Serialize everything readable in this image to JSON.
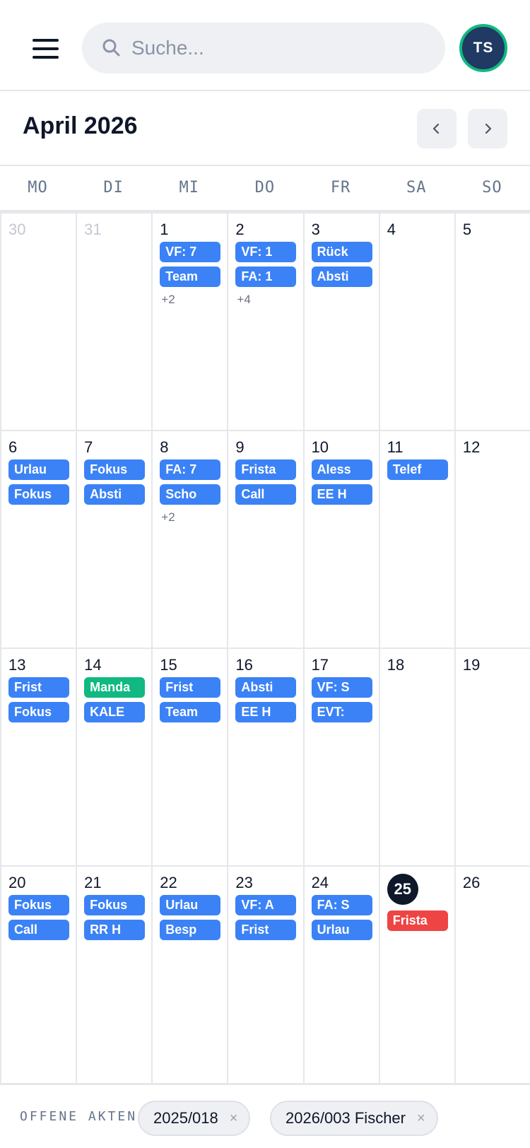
{
  "header": {
    "search_placeholder": "Suche...",
    "avatar_initials": "TS",
    "avatar_color": "#203a63",
    "avatar_ring_color": "#10b981"
  },
  "calendar": {
    "month_label": "April 2026",
    "prev_icon": "chevron-left-icon",
    "next_icon": "chevron-right-icon",
    "weekdays": [
      "MO",
      "DI",
      "MI",
      "DO",
      "FR",
      "SA",
      "SO"
    ],
    "weeks": [
      [
        {
          "day": "30",
          "outside": true,
          "events": []
        },
        {
          "day": "31",
          "outside": true,
          "events": []
        },
        {
          "day": "1",
          "events": [
            {
              "label": "VF: 7",
              "color": "blue"
            },
            {
              "label": "Team",
              "color": "blue"
            }
          ],
          "more": "+2"
        },
        {
          "day": "2",
          "events": [
            {
              "label": "VF: 1",
              "color": "blue"
            },
            {
              "label": "FA: 1",
              "color": "blue"
            }
          ],
          "more": "+4"
        },
        {
          "day": "3",
          "events": [
            {
              "label": "Rück",
              "color": "blue"
            },
            {
              "label": "Absti",
              "color": "blue"
            }
          ]
        },
        {
          "day": "4",
          "events": []
        },
        {
          "day": "5",
          "events": []
        }
      ],
      [
        {
          "day": "6",
          "events": [
            {
              "label": "Urlau",
              "color": "blue"
            },
            {
              "label": "Fokus",
              "color": "blue"
            }
          ]
        },
        {
          "day": "7",
          "events": [
            {
              "label": "Fokus",
              "color": "blue"
            },
            {
              "label": "Absti",
              "color": "blue"
            }
          ]
        },
        {
          "day": "8",
          "events": [
            {
              "label": "FA: 7",
              "color": "blue"
            },
            {
              "label": "Scho",
              "color": "blue"
            }
          ],
          "more": "+2"
        },
        {
          "day": "9",
          "events": [
            {
              "label": "Frista",
              "color": "blue"
            },
            {
              "label": "Call",
              "color": "blue"
            }
          ]
        },
        {
          "day": "10",
          "events": [
            {
              "label": "Aless",
              "color": "blue"
            },
            {
              "label": "EE H",
              "color": "blue"
            }
          ]
        },
        {
          "day": "11",
          "events": [
            {
              "label": "Telef",
              "color": "blue"
            }
          ]
        },
        {
          "day": "12",
          "events": []
        }
      ],
      [
        {
          "day": "13",
          "events": [
            {
              "label": "Frist",
              "color": "blue"
            },
            {
              "label": "Fokus",
              "color": "blue"
            }
          ]
        },
        {
          "day": "14",
          "events": [
            {
              "label": "Manda",
              "color": "green"
            },
            {
              "label": "KALE",
              "color": "blue"
            }
          ]
        },
        {
          "day": "15",
          "events": [
            {
              "label": "Frist",
              "color": "blue"
            },
            {
              "label": "Team",
              "color": "blue"
            }
          ]
        },
        {
          "day": "16",
          "events": [
            {
              "label": "Absti",
              "color": "blue"
            },
            {
              "label": "EE H",
              "color": "blue"
            }
          ]
        },
        {
          "day": "17",
          "events": [
            {
              "label": "VF: S",
              "color": "blue"
            },
            {
              "label": "EVT:",
              "color": "blue"
            }
          ]
        },
        {
          "day": "18",
          "events": []
        },
        {
          "day": "19",
          "events": []
        }
      ],
      [
        {
          "day": "20",
          "events": [
            {
              "label": "Fokus",
              "color": "blue"
            },
            {
              "label": "Call",
              "color": "blue"
            }
          ]
        },
        {
          "day": "21",
          "events": [
            {
              "label": "Fokus",
              "color": "blue"
            },
            {
              "label": "RR H",
              "color": "blue"
            }
          ]
        },
        {
          "day": "22",
          "events": [
            {
              "label": "Urlau",
              "color": "blue"
            },
            {
              "label": "Besp",
              "color": "blue"
            }
          ]
        },
        {
          "day": "23",
          "events": [
            {
              "label": "VF: A",
              "color": "blue"
            },
            {
              "label": "Frist",
              "color": "blue"
            }
          ]
        },
        {
          "day": "24",
          "events": [
            {
              "label": "FA: S",
              "color": "blue"
            },
            {
              "label": "Urlau",
              "color": "blue"
            }
          ]
        },
        {
          "day": "25",
          "today": true,
          "events": [
            {
              "label": "Frista",
              "color": "red"
            }
          ]
        },
        {
          "day": "26",
          "events": []
        }
      ]
    ],
    "colors": {
      "blue": "#3b82f6",
      "green": "#10b981",
      "red": "#ef4444",
      "today": "#0f172a"
    }
  },
  "footer": {
    "label": "OFFENE AKTEN",
    "chips": [
      {
        "label": "2025/018",
        "close": "×"
      },
      {
        "label": "2026/003 Fischer",
        "close": "×"
      }
    ]
  }
}
